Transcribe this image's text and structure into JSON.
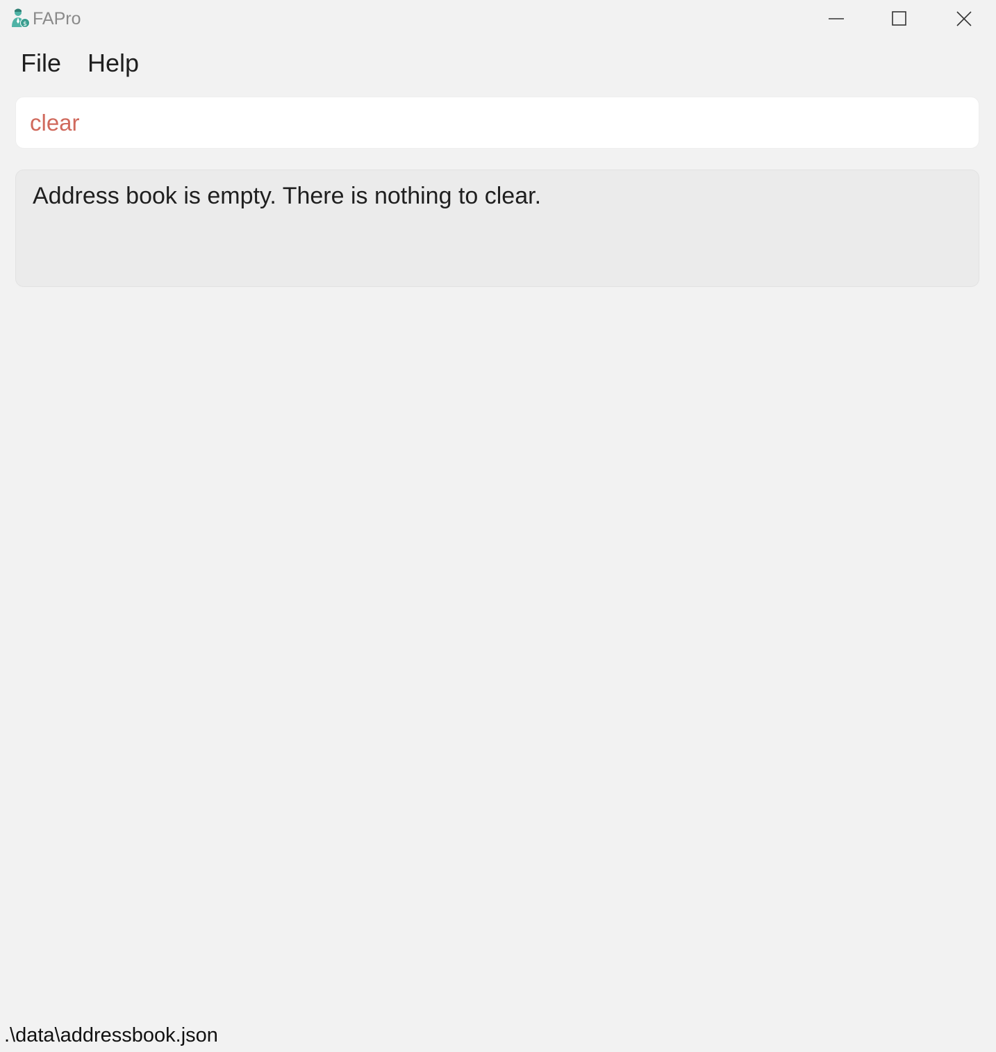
{
  "window": {
    "title": "FAPro",
    "controls": {
      "minimize_icon": "minimize-icon",
      "maximize_icon": "maximize-icon",
      "close_icon": "close-icon"
    }
  },
  "menu": {
    "items": [
      {
        "label": "File"
      },
      {
        "label": "Help"
      }
    ]
  },
  "command_box": {
    "value": "clear",
    "text_color": "#d0695c"
  },
  "result_display": {
    "message": "Address book is empty. There is nothing to clear."
  },
  "status_bar": {
    "file_path": ".\\data\\addressbook.json"
  },
  "colors": {
    "background": "#f2f2f2",
    "icon_teal": "#4fb3a6",
    "error_text": "#d0695c"
  }
}
